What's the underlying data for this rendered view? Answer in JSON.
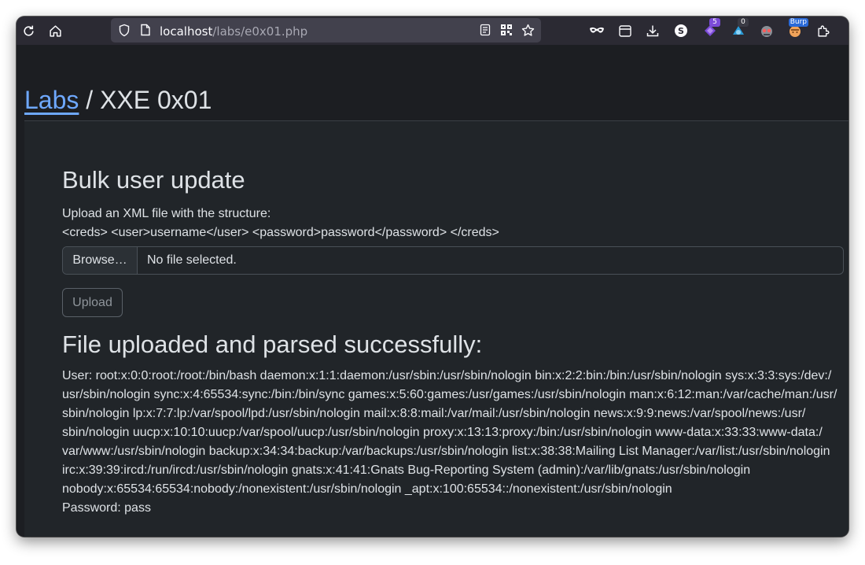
{
  "browser": {
    "url_host": "localhost",
    "url_path": "/labs/e0x01.php",
    "icons": {
      "reload": "reload-icon",
      "home": "home-icon",
      "shield": "shield-icon",
      "page": "page-icon",
      "reader": "reader-view-icon",
      "qr": "qr-code-icon",
      "bookmark": "star-icon"
    },
    "extensions": {
      "private_badge": "",
      "badge_purple": "5",
      "badge_blue": "0",
      "badge_burp": "Burp"
    }
  },
  "page": {
    "breadcrumb_link": "Labs",
    "breadcrumb_sep": " / ",
    "breadcrumb_current": "XXE 0x01",
    "heading": "Bulk user update",
    "desc_line1": "Upload an XML file with the structure:",
    "desc_line2": "<creds> <user>username</user> <password>password</password> </creds>",
    "browse_label": "Browse…",
    "file_status": "No file selected.",
    "upload_label": "Upload",
    "result_heading": "File uploaded and parsed successfully:",
    "output_lines": [
      "User: root:x:0:0:root:/root:/bin/bash daemon:x:1:1:daemon:/usr/sbin:/usr/sbin/nologin bin:x:2:2:bin:/bin:/usr/sbin/nologin sys:x:3:3:sys:/dev:/",
      "usr/sbin/nologin sync:x:4:65534:sync:/bin:/bin/sync games:x:5:60:games:/usr/games:/usr/sbin/nologin man:x:6:12:man:/var/cache/man:/usr/",
      "sbin/nologin lp:x:7:7:lp:/var/spool/lpd:/usr/sbin/nologin mail:x:8:8:mail:/var/mail:/usr/sbin/nologin news:x:9:9:news:/var/spool/news:/usr/",
      "sbin/nologin uucp:x:10:10:uucp:/var/spool/uucp:/usr/sbin/nologin proxy:x:13:13:proxy:/bin:/usr/sbin/nologin www-data:x:33:33:www-data:/",
      "var/www:/usr/sbin/nologin backup:x:34:34:backup:/var/backups:/usr/sbin/nologin list:x:38:38:Mailing List Manager:/var/list:/usr/sbin/nologin",
      "irc:x:39:39:ircd:/run/ircd:/usr/sbin/nologin gnats:x:41:41:Gnats Bug-Reporting System (admin):/var/lib/gnats:/usr/sbin/nologin",
      "nobody:x:65534:65534:nobody:/nonexistent:/usr/sbin/nologin _apt:x:100:65534::/nonexistent:/usr/sbin/nologin"
    ],
    "password_line": "Password: pass"
  },
  "colors": {
    "link": "#6ea8fe",
    "text": "#dee2e6",
    "panel": "#212529",
    "toolbar": "#2b2a33"
  }
}
